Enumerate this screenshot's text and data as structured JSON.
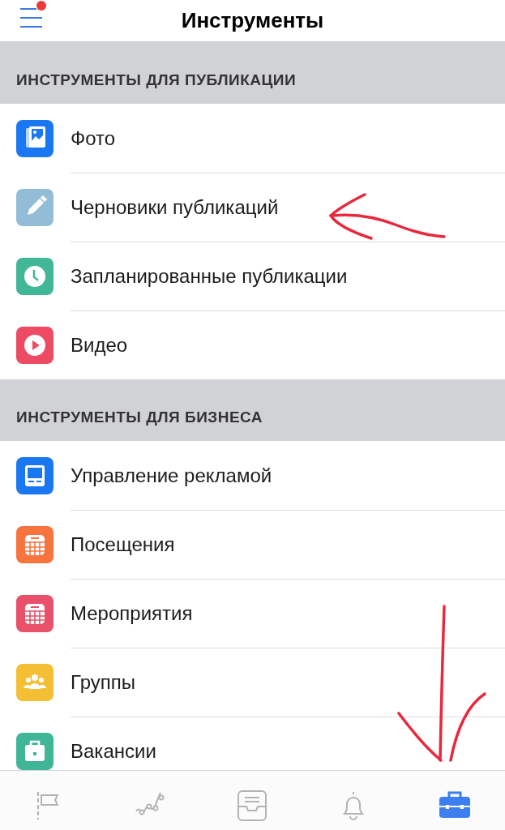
{
  "header": {
    "title": "Инструменты",
    "menu_badge": true
  },
  "sections": [
    {
      "title": "ИНСТРУМЕНТЫ ДЛЯ ПУБЛИКАЦИИ",
      "items": [
        {
          "label": "Фото",
          "kind": "photo",
          "color": "#1a77f2"
        },
        {
          "label": "Черновики публикаций",
          "kind": "pencil",
          "color": "#93bcd6"
        },
        {
          "label": "Запланированные публикации",
          "kind": "clock",
          "color": "#42b797"
        },
        {
          "label": "Видео",
          "kind": "play",
          "color": "#ec4b63"
        }
      ]
    },
    {
      "title": "ИНСТРУМЕНТЫ ДЛЯ БИЗНЕСА",
      "items": [
        {
          "label": "Управление рекламой",
          "kind": "monitor",
          "color": "#1a77f2"
        },
        {
          "label": "Посещения",
          "kind": "calendar",
          "color": "#f7743f"
        },
        {
          "label": "Мероприятия",
          "kind": "calendar",
          "color": "#e9506a"
        },
        {
          "label": "Группы",
          "kind": "people",
          "color": "#f4bf35"
        },
        {
          "label": "Вакансии",
          "kind": "briefcase",
          "color": "#3fb697"
        }
      ]
    }
  ],
  "tab_bar": [
    {
      "kind": "flag",
      "selected": false
    },
    {
      "kind": "chart",
      "selected": false
    },
    {
      "kind": "inbox",
      "selected": false
    },
    {
      "kind": "bell",
      "selected": false
    },
    {
      "kind": "briefcase",
      "selected": true
    }
  ]
}
